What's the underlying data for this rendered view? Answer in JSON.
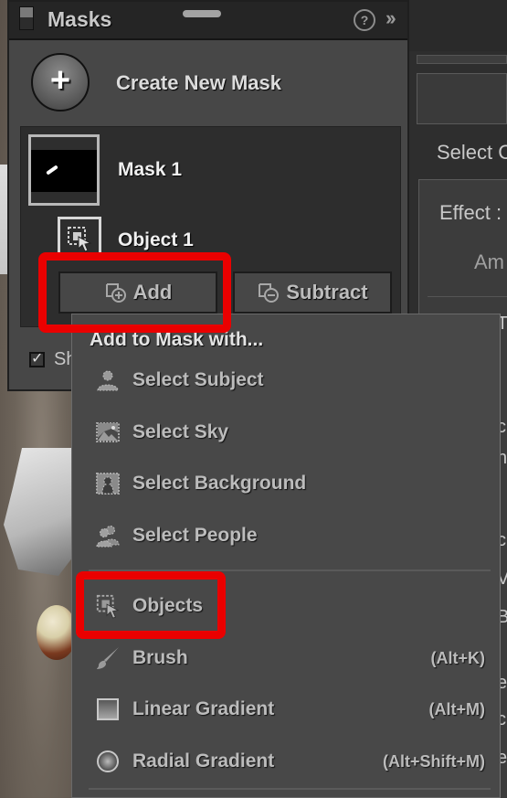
{
  "masks_panel": {
    "title": "Masks",
    "help_icon": "help-circle-icon",
    "collapse_icon": "double-chevron-right-icon",
    "create_new_mask_label": "Create New Mask",
    "masks": [
      {
        "name": "Mask 1",
        "components": [
          {
            "name": "Object 1",
            "icon": "object-select-icon"
          }
        ]
      }
    ],
    "add_label": "Add",
    "subtract_label": "Subtract",
    "show_overlay_label": "Sh",
    "show_overlay_checked": true
  },
  "add_menu": {
    "heading": "Add to Mask with...",
    "items": [
      {
        "label": "Select Subject",
        "icon": "select-subject-icon",
        "shortcut": ""
      },
      {
        "label": "Select Sky",
        "icon": "select-sky-icon",
        "shortcut": ""
      },
      {
        "label": "Select Background",
        "icon": "select-background-icon",
        "shortcut": ""
      },
      {
        "label": "Select People",
        "icon": "select-people-icon",
        "shortcut": ""
      },
      {
        "label": "Objects",
        "icon": "objects-icon",
        "shortcut": ""
      },
      {
        "label": "Brush",
        "icon": "brush-icon",
        "shortcut": "(Alt+K)"
      },
      {
        "label": "Linear Gradient",
        "icon": "linear-gradient-icon",
        "shortcut": "(Alt+M)"
      },
      {
        "label": "Radial Gradient",
        "icon": "radial-gradient-icon",
        "shortcut": "(Alt+Shift+M)"
      }
    ]
  },
  "right_panel": {
    "select_text": "Select C",
    "effect_text": "Effect :",
    "amount_text": "Am",
    "clipped_letters": [
      "T",
      "c",
      "n",
      "l",
      "c",
      "V",
      "B",
      "e",
      "c",
      "e"
    ]
  },
  "annotations": {
    "highlight_color": "#ea0000",
    "highlighted": [
      "Add",
      "Objects"
    ]
  }
}
